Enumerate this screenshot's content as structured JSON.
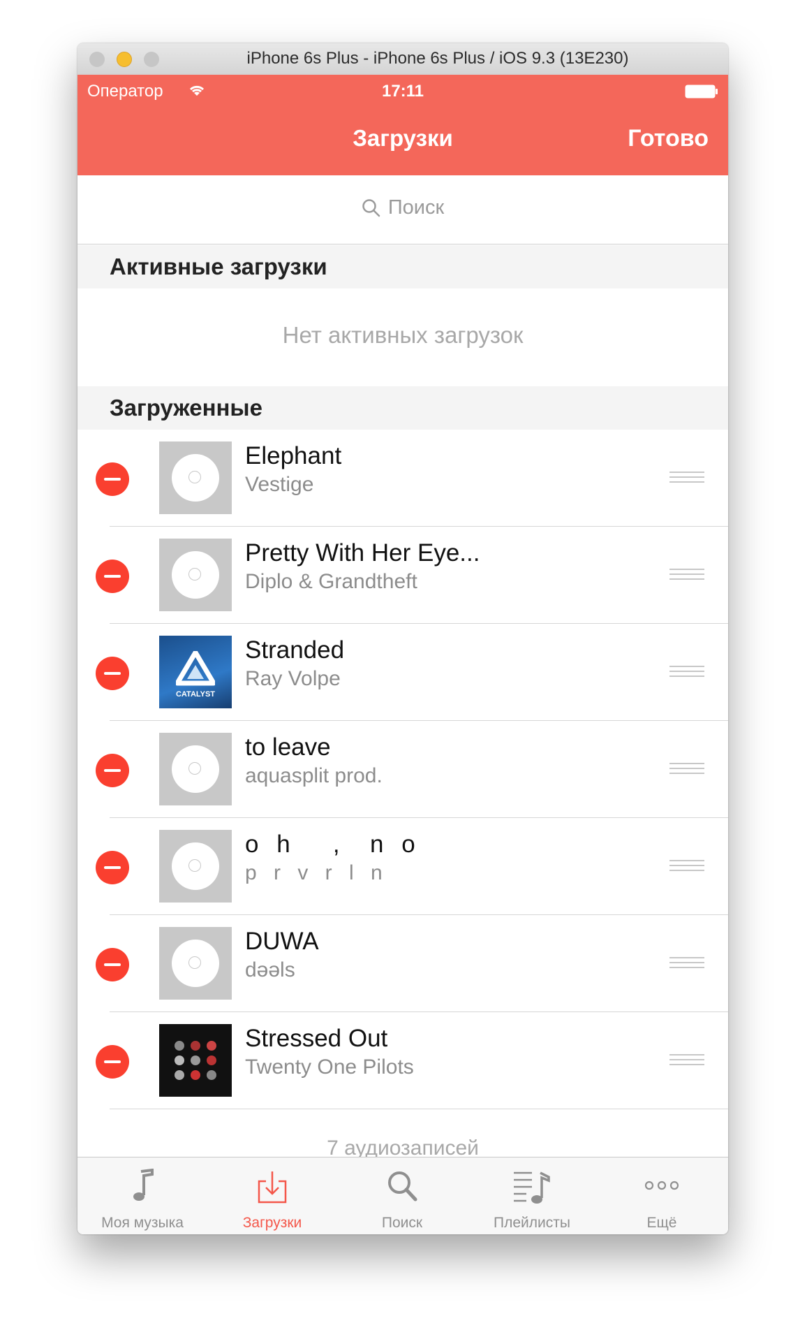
{
  "window": {
    "title": "iPhone 6s Plus - iPhone 6s Plus / iOS 9.3 (13E230)"
  },
  "status_bar": {
    "carrier": "Оператор",
    "time": "17:11"
  },
  "navbar": {
    "title": "Загрузки",
    "done_label": "Готово"
  },
  "search": {
    "placeholder": "Поиск"
  },
  "sections": {
    "active": {
      "header": "Активные загрузки",
      "empty_text": "Нет активных загрузок"
    },
    "downloaded": {
      "header": "Загруженные"
    }
  },
  "tracks": [
    {
      "title": "Elephant",
      "artist": "Vestige",
      "artwork": "placeholder-disc"
    },
    {
      "title": "Pretty With Her Eye...",
      "artist": "Diplo & Grandtheft",
      "artwork": "placeholder-disc"
    },
    {
      "title": "Stranded",
      "artist": "Ray Volpe",
      "artwork": "catalyst-cover",
      "artwork_caption": "CATALYST"
    },
    {
      "title": "to leave",
      "artist": "aquasplit prod.",
      "artwork": "placeholder-disc"
    },
    {
      "title": "o h   ,  n o",
      "artist": "p r v r l n",
      "artwork": "placeholder-disc"
    },
    {
      "title": "DUWA",
      "artist": "dəəls",
      "artwork": "placeholder-disc"
    },
    {
      "title": "Stressed Out",
      "artist": "Twenty One Pilots",
      "artwork": "blurryface-cover"
    }
  ],
  "footer": {
    "count_text": "7  аудиозаписей"
  },
  "tabbar": {
    "items": [
      {
        "label": "Моя музыка",
        "icon": "music-note-icon"
      },
      {
        "label": "Загрузки",
        "icon": "download-tray-icon",
        "active": true
      },
      {
        "label": "Поиск",
        "icon": "search-icon"
      },
      {
        "label": "Плейлисты",
        "icon": "playlist-icon"
      },
      {
        "label": "Ещё",
        "icon": "more-dots-icon"
      }
    ]
  },
  "colors": {
    "accent": "#f4675a",
    "delete": "#fa3f2f",
    "tab_active": "#f4574a"
  }
}
